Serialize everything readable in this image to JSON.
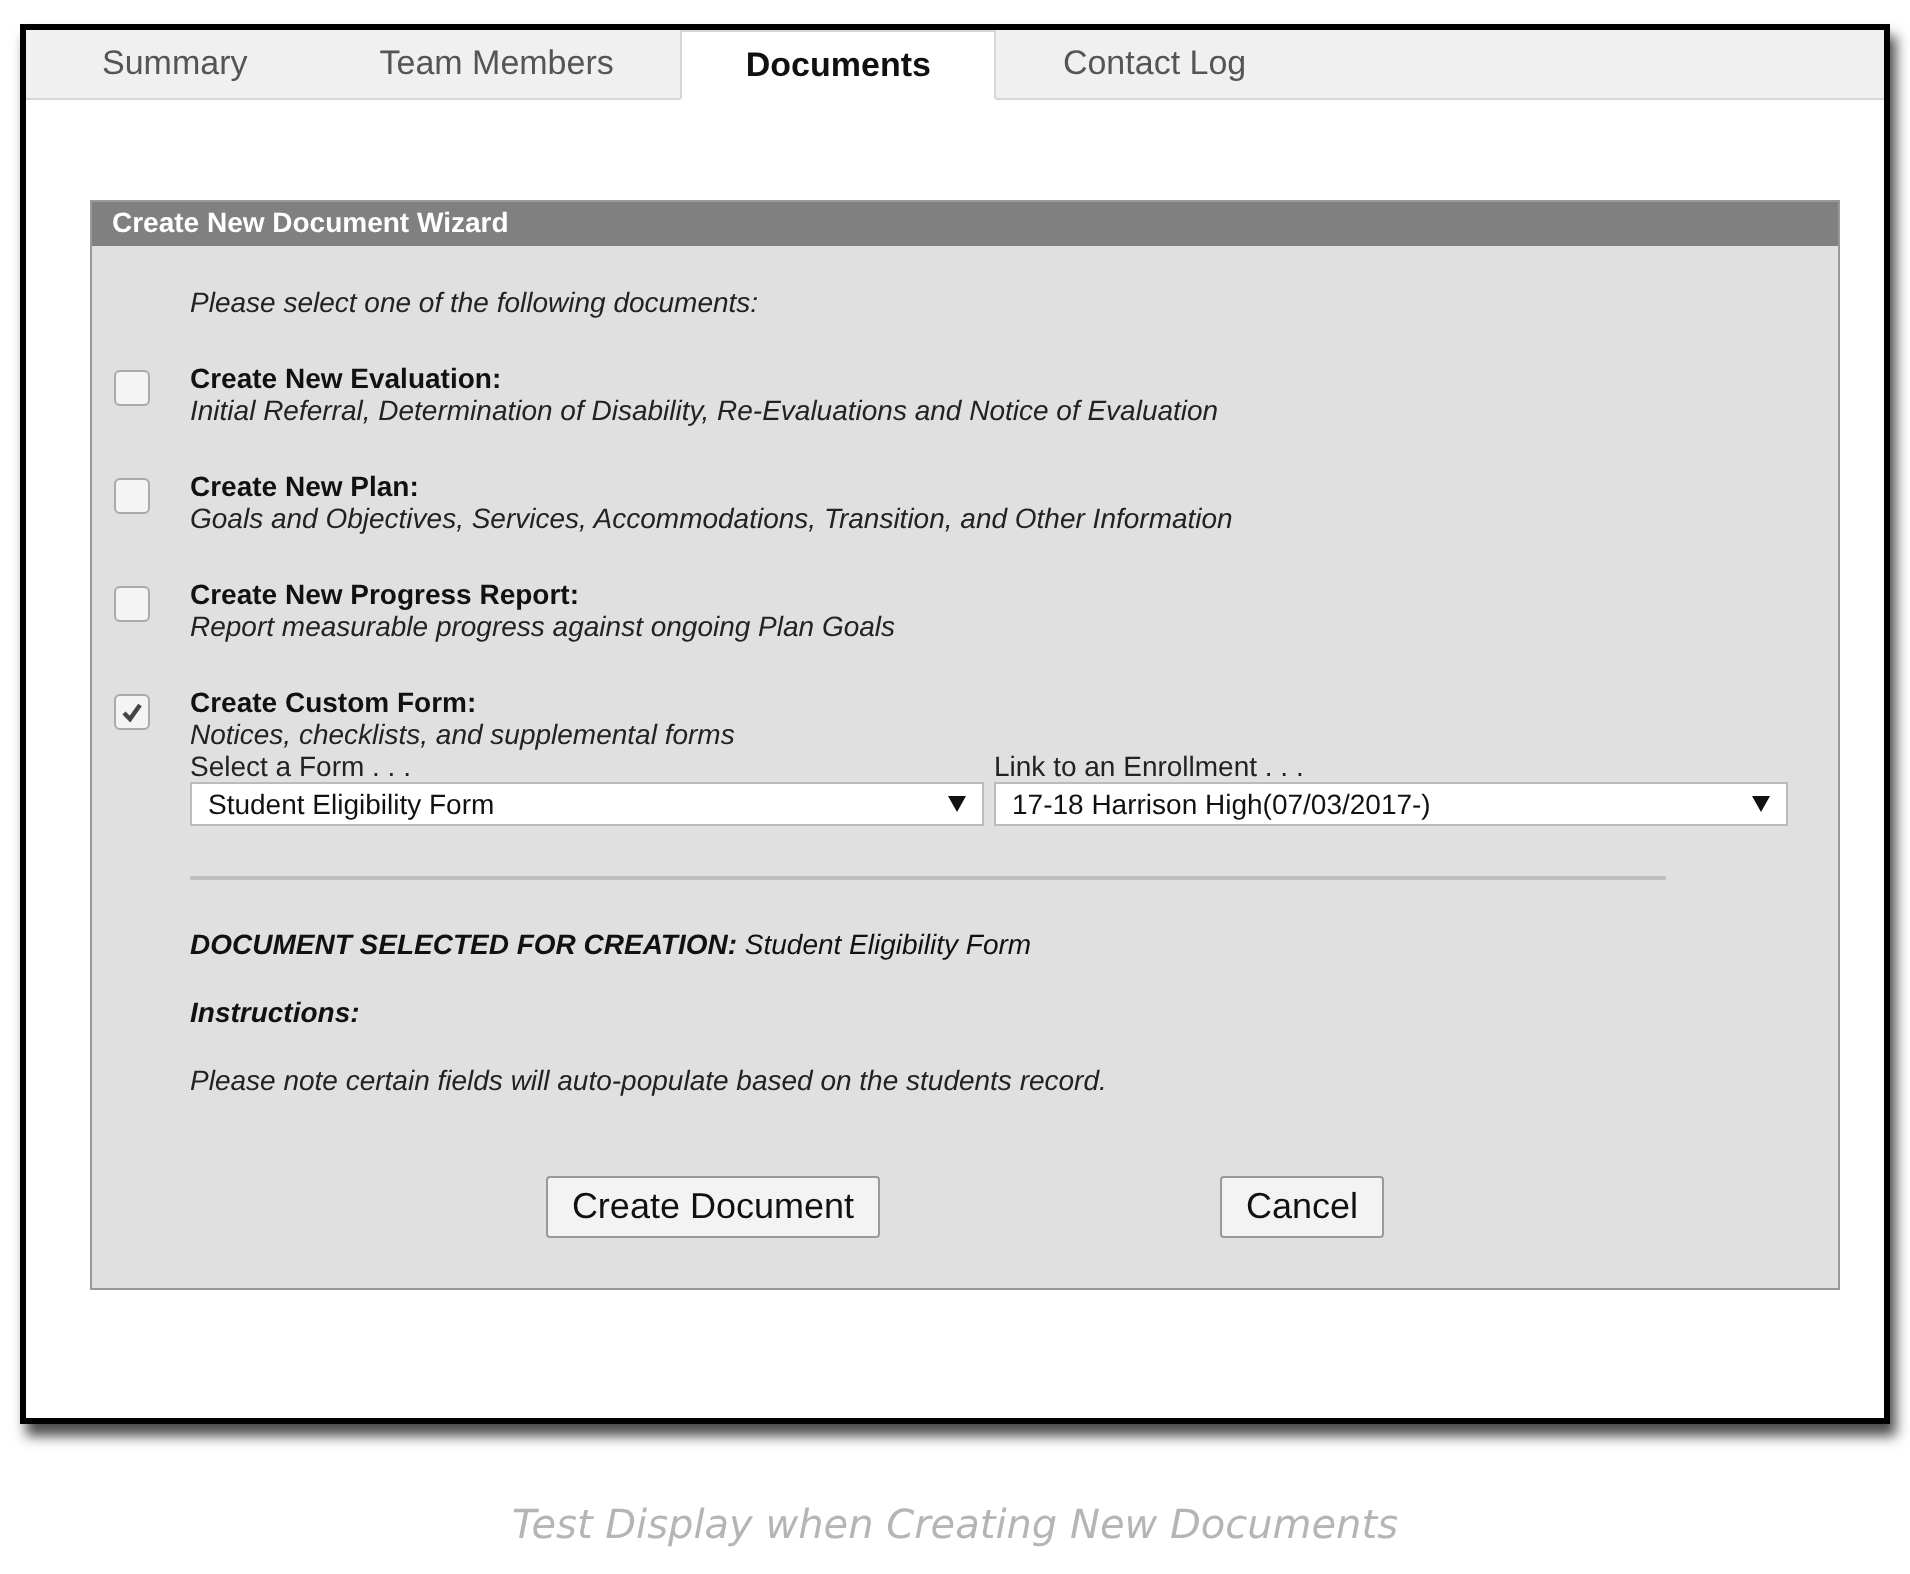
{
  "tabs": [
    {
      "label": "Summary",
      "selected": false
    },
    {
      "label": "Team Members",
      "selected": false
    },
    {
      "label": "Documents",
      "selected": true
    },
    {
      "label": "Contact Log",
      "selected": false
    }
  ],
  "wizard": {
    "title": "Create New Document Wizard",
    "prompt": "Please select one of the following documents:",
    "options": [
      {
        "title": "Create New Evaluation:",
        "description": "Initial Referral, Determination of Disability, Re-Evaluations and Notice of Evaluation",
        "checked": false
      },
      {
        "title": "Create New Plan:",
        "description": "Goals and Objectives, Services, Accommodations, Transition, and Other Information",
        "checked": false
      },
      {
        "title": "Create New Progress Report:",
        "description": "Report measurable progress against ongoing Plan Goals",
        "checked": false
      },
      {
        "title": "Create Custom Form:",
        "description": "Notices, checklists, and supplemental forms",
        "checked": true
      }
    ],
    "selects": [
      {
        "label": "Select a Form . . .",
        "value": "Student Eligibility Form"
      },
      {
        "label": "Link to an Enrollment . . .",
        "value": "17-18 Harrison High(07/03/2017-)"
      }
    ],
    "selected_line": "**DOCUMENT SELECTED FOR CREATION:** Student Eligibility Form",
    "instructions_label": "Instructions:",
    "instructions_text": "Please note certain fields will auto-populate based on the students record.",
    "buttons": [
      "Create Document",
      "Cancel"
    ]
  },
  "caption": "Test Display when Creating New Documents"
}
